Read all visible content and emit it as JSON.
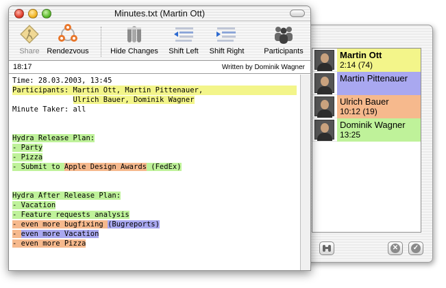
{
  "window": {
    "title": "Minutes.txt (Martin Ott)"
  },
  "toolbar": {
    "items": [
      {
        "label": "Share",
        "icon": "share-icon",
        "enabled": false
      },
      {
        "label": "Rendezvous",
        "icon": "rendezvous-icon",
        "enabled": true
      },
      {
        "label": "Hide Changes",
        "icon": "hide-changes-icon",
        "enabled": true
      },
      {
        "label": "Shift Left",
        "icon": "shift-left-icon",
        "enabled": true
      },
      {
        "label": "Shift Right",
        "icon": "shift-right-icon",
        "enabled": true
      },
      {
        "label": "Participants",
        "icon": "participants-icon",
        "enabled": true
      }
    ]
  },
  "status": {
    "position": "18:17",
    "author": "Written by Dominik Wagner"
  },
  "colors": {
    "martin_ott": "#f3f58a",
    "martin_pittenauer": "#a9a8f0",
    "ulrich_bauer": "#f6b98d",
    "dominik_wagner": "#bff29a"
  },
  "document": {
    "l01": "Time: 28.03.2003, 13:45",
    "l02a": "Participants: ",
    "l02b": "Martin Ott, Martin Pittenauer,",
    "l03a": "              ",
    "l03b": "Ulrich Bauer, Dominik Wagner",
    "l04": "Minute Taker: all",
    "l07": "Hydra Release Plan:",
    "l08": "- Party",
    "l09": "- Pizza",
    "l10a": "- Submit to ",
    "l10b": "Apple Design Awards",
    "l10c": " (FedEx)",
    "l13": "Hydra After Release Plan:",
    "l14": "- Vacation",
    "l15": "- Feature requests analysis",
    "l16a": "- even more bugfixing ",
    "l16b": "(Bugreports)",
    "l17a": "- ",
    "l17b": "even more Vacation",
    "l18": "- even more Pizza"
  },
  "participants": [
    {
      "name": "Martin Ott",
      "detail": "2:14 (74)",
      "color": "#f3f58a"
    },
    {
      "name": "Martin Pittenauer",
      "detail": "",
      "color": "#a9a8f0"
    },
    {
      "name": "Ulrich Bauer",
      "detail": "10:12 (19)",
      "color": "#f6b98d"
    },
    {
      "name": "Dominik Wagner",
      "detail": "13:25",
      "color": "#bff29a"
    }
  ]
}
